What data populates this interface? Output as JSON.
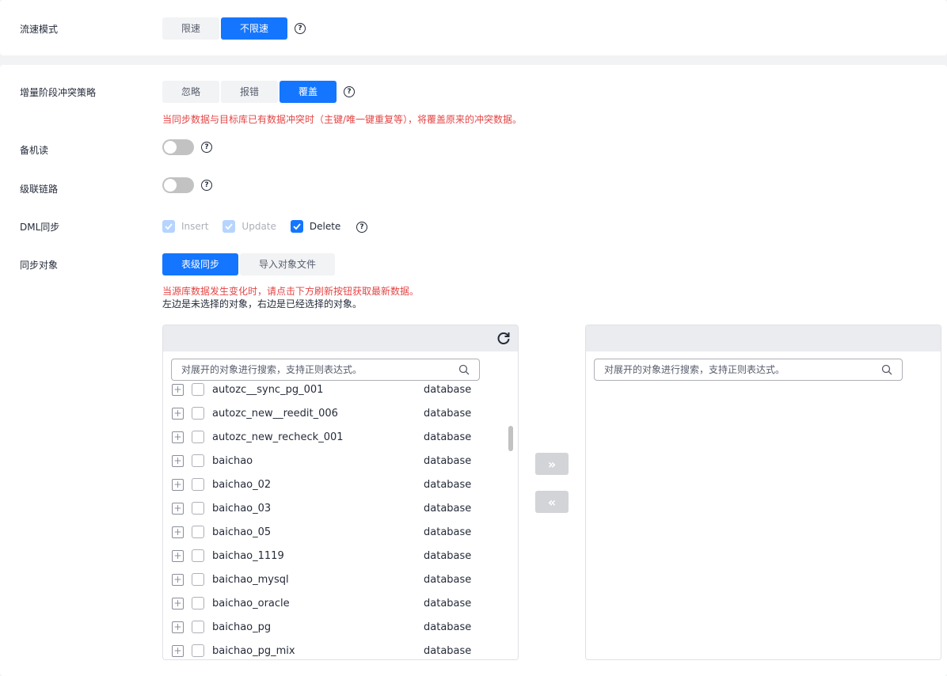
{
  "flow_mode": {
    "label": "流速模式",
    "options": [
      "限速",
      "不限速"
    ],
    "selected": "不限速",
    "help": "?"
  },
  "conflict_policy": {
    "label": "增量阶段冲突策略",
    "options": [
      "忽略",
      "报错",
      "覆盖"
    ],
    "selected": "覆盖",
    "help": "?",
    "warning": "当同步数据与目标库已有数据冲突时（主键/唯一键重复等），将覆盖原来的冲突数据。"
  },
  "standby_read": {
    "label": "备机读",
    "enabled": false,
    "help": "?"
  },
  "cascade_link": {
    "label": "级联链路",
    "enabled": false,
    "help": "?"
  },
  "dml_sync": {
    "label": "DML同步",
    "help": "?",
    "options": [
      {
        "label": "Insert",
        "checked": true,
        "disabled": true
      },
      {
        "label": "Update",
        "checked": true,
        "disabled": true
      },
      {
        "label": "Delete",
        "checked": true,
        "disabled": false
      }
    ]
  },
  "sync_object": {
    "label": "同步对象",
    "tabs": [
      "表级同步",
      "导入对象文件"
    ],
    "selected": "表级同步",
    "warning": "当源库数据发生变化时，请点击下方刷新按钮获取最新数据。",
    "note": "左边是未选择的对象，右边是已经选择的对象。"
  },
  "left_panel": {
    "search_placeholder": "对展开的对象进行搜索，支持正则表达式。",
    "items": [
      {
        "name": "autozc__sync_pg_001",
        "type": "database"
      },
      {
        "name": "autozc_new__reedit_006",
        "type": "database"
      },
      {
        "name": "autozc_new_recheck_001",
        "type": "database"
      },
      {
        "name": "baichao",
        "type": "database"
      },
      {
        "name": "baichao_02",
        "type": "database"
      },
      {
        "name": "baichao_03",
        "type": "database"
      },
      {
        "name": "baichao_05",
        "type": "database"
      },
      {
        "name": "baichao_1119",
        "type": "database"
      },
      {
        "name": "baichao_mysql",
        "type": "database"
      },
      {
        "name": "baichao_oracle",
        "type": "database"
      },
      {
        "name": "baichao_pg",
        "type": "database"
      },
      {
        "name": "baichao_pg_mix",
        "type": "database"
      }
    ]
  },
  "right_panel": {
    "search_placeholder": "对展开的对象进行搜索，支持正则表达式。"
  },
  "transfer": {
    "add": "»",
    "remove": "«"
  },
  "colors": {
    "accent": "#1476ff",
    "warning": "#e54545",
    "disabled_check": "#b6d4ff"
  }
}
